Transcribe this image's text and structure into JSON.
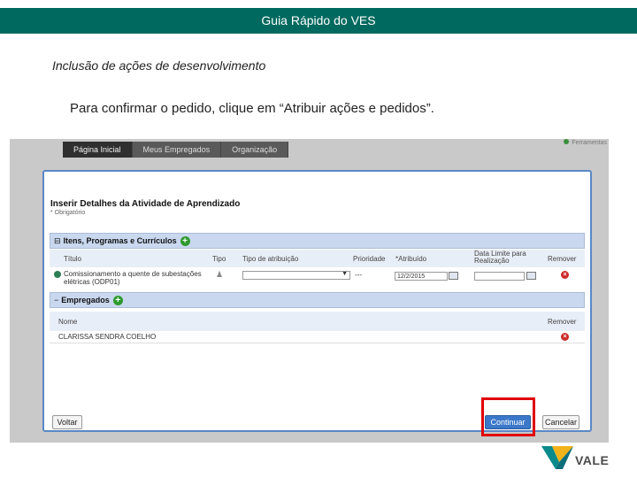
{
  "header": {
    "title": "Guia Rápido do VES"
  },
  "section": {
    "subtitle": "Inclusão de ações de desenvolvimento"
  },
  "instruction": "Para confirmar o pedido, clique em “Atribuir ações e pedidos”.",
  "app": {
    "tabs": [
      "Página Inicial",
      "Meus Empregados",
      "Organização"
    ],
    "top_link": "Ferramentas",
    "dialog": {
      "title": "Inserir Detalhes da Atividade de Aprendizado",
      "required_note": "* Obrigatório",
      "items_section": {
        "label": "Itens, Programas e Currículos",
        "columns": {
          "title": "Título",
          "type": "Tipo",
          "assignment_type": "Tipo de atribuição",
          "priority": "Prioridade",
          "assigned": "*Atribuído",
          "due_date": "Data Limite para Realização",
          "remove": "Remover"
        },
        "row": {
          "title": "Comissionamento a quente de subestações elétricas (ODP01)",
          "priority": "---",
          "assigned_date": "12/2/2015",
          "due_date": ""
        }
      },
      "employees_section": {
        "label": "Empregados",
        "columns": {
          "name": "Nome",
          "remove": "Remover"
        },
        "row": {
          "name": "CLARISSA SENDRA COELHO"
        }
      },
      "buttons": {
        "back": "Voltar",
        "continue": "Continuar",
        "cancel": "Cancelar"
      }
    }
  },
  "logo": {
    "text": "VALE"
  },
  "colors": {
    "brand": "#00695f",
    "highlight": "#e00000",
    "accent": "#3b78c9"
  }
}
